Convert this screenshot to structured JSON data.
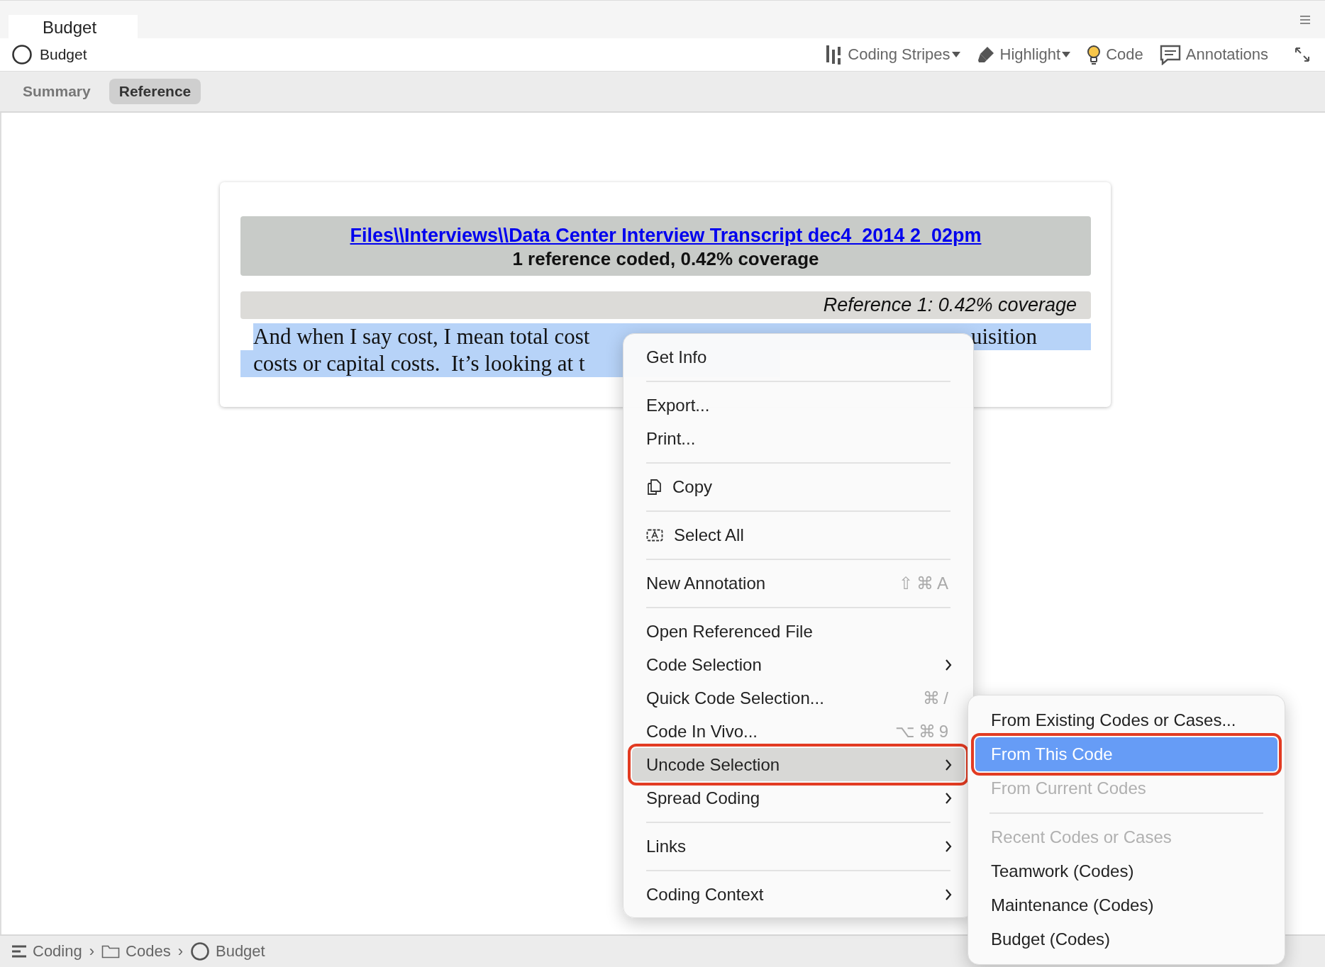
{
  "window": {
    "tab_title": "Budget"
  },
  "header": {
    "title": "Budget"
  },
  "toolbar": [
    {
      "kind": "stripes",
      "label": "Coding Stripes",
      "dropdown": true
    },
    {
      "kind": "highlight",
      "label": "Highlight",
      "dropdown": true
    },
    {
      "kind": "code",
      "label": "Code",
      "dropdown": false
    },
    {
      "kind": "annotations",
      "label": "Annotations",
      "dropdown": false
    }
  ],
  "view_tabs": [
    {
      "label": "Summary",
      "selected": false
    },
    {
      "label": "Reference",
      "selected": true
    }
  ],
  "document": {
    "source_link": "Files\\\\Interviews\\\\Data Center Interview Transcript dec4_2014 2_02pm",
    "summary": "1 reference coded, 0.42% coverage",
    "reference_label": "Reference 1: 0.42% coverage",
    "line_1": "And when I say cost, I mean total cost",
    "line_1_end": "uisition",
    "line_2": "costs or capital costs.  It’s looking at t"
  },
  "context_menu": [
    {
      "kind": "item",
      "label": "Get Info",
      "submenu": false,
      "selected": false,
      "marked": false
    },
    {
      "kind": "separator"
    },
    {
      "kind": "item",
      "label": "Export...",
      "submenu": false,
      "selected": false,
      "marked": false
    },
    {
      "kind": "item",
      "label": "Print...",
      "submenu": false,
      "selected": false,
      "marked": false
    },
    {
      "kind": "separator"
    },
    {
      "kind": "copy",
      "label": "Copy",
      "submenu": false,
      "selected": false,
      "marked": false
    },
    {
      "kind": "separator"
    },
    {
      "kind": "select_all",
      "label": "Select All",
      "submenu": false,
      "selected": false,
      "marked": false
    },
    {
      "kind": "separator"
    },
    {
      "kind": "item",
      "label": "New Annotation",
      "shortcut": "⇧⌘A",
      "submenu": false,
      "selected": false,
      "marked": false
    },
    {
      "kind": "separator"
    },
    {
      "kind": "item",
      "label": "Open Referenced File",
      "submenu": false,
      "selected": false,
      "marked": false
    },
    {
      "kind": "item",
      "label": "Code Selection",
      "submenu": true,
      "selected": false,
      "marked": false
    },
    {
      "kind": "item",
      "label": "Quick Code Selection...",
      "shortcut": "⌘/",
      "submenu": false,
      "selected": false,
      "marked": false
    },
    {
      "kind": "item",
      "label": "Code In Vivo...",
      "shortcut": "⌥⌘9",
      "submenu": false,
      "selected": false,
      "marked": false
    },
    {
      "kind": "item",
      "label": "Uncode Selection",
      "submenu": true,
      "selected": true,
      "marked": true
    },
    {
      "kind": "item",
      "label": "Spread Coding",
      "submenu": true,
      "selected": false,
      "marked": false
    },
    {
      "kind": "separator"
    },
    {
      "kind": "item",
      "label": "Links",
      "submenu": true,
      "selected": false,
      "marked": false
    },
    {
      "kind": "separator"
    },
    {
      "kind": "item",
      "label": "Coding Context",
      "submenu": true,
      "selected": false,
      "marked": false
    }
  ],
  "submenu": [
    {
      "kind": "item",
      "label": "From Existing Codes or Cases...",
      "disabled": false,
      "selected": false,
      "marked": false
    },
    {
      "kind": "item",
      "label": "From This Code",
      "disabled": false,
      "selected": true,
      "marked": true
    },
    {
      "kind": "item",
      "label": "From Current Codes",
      "disabled": true,
      "selected": false,
      "marked": false
    },
    {
      "kind": "separator"
    },
    {
      "kind": "item",
      "label": "Recent Codes or Cases",
      "disabled": true,
      "selected": false,
      "marked": false
    },
    {
      "kind": "item",
      "label": "Teamwork (Codes)",
      "disabled": false,
      "selected": false,
      "marked": false
    },
    {
      "kind": "item",
      "label": "Maintenance (Codes)",
      "disabled": false,
      "selected": false,
      "marked": false
    },
    {
      "kind": "item",
      "label": "Budget (Codes)",
      "disabled": false,
      "selected": false,
      "marked": false
    }
  ],
  "breadcrumb": [
    {
      "kind": "list",
      "label": "Coding"
    },
    {
      "kind": "folder",
      "label": "Codes"
    },
    {
      "kind": "node",
      "label": "Budget"
    }
  ],
  "breadcrumb_separators": [
    "›",
    "›"
  ]
}
